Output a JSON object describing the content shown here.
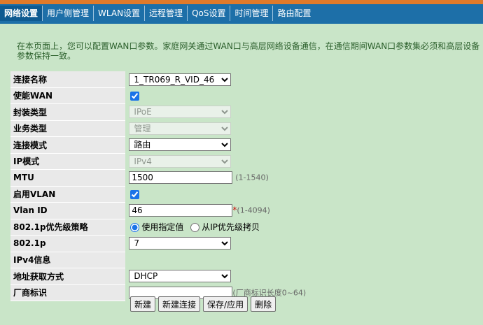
{
  "nav": {
    "items": [
      "网络设置",
      "用户侧管理",
      "WLAN设置",
      "远程管理",
      "QoS设置",
      "时间管理",
      "路由配置"
    ],
    "active_index": 0
  },
  "intro_text": "在本页面上，您可以配置WAN口参数。家庭网关通过WAN口与高层网络设备通信，在通信期间WAN口参数集必须和高层设备参数保持一致。",
  "form": {
    "connection_name": {
      "label": "连接名称",
      "value": "1_TR069_R_VID_46"
    },
    "enable_wan": {
      "label": "使能WAN",
      "checked": true
    },
    "encap_type": {
      "label": "封装类型",
      "value": "IPoE"
    },
    "service_type": {
      "label": "业务类型",
      "value": "管理"
    },
    "conn_mode": {
      "label": "连接模式",
      "value": "路由"
    },
    "ip_mode": {
      "label": "IP模式",
      "value": "IPv4"
    },
    "mtu": {
      "label": "MTU",
      "value": "1500",
      "hint": "(1-1540)"
    },
    "enable_vlan": {
      "label": "启用VLAN",
      "checked": true
    },
    "vlan_id": {
      "label": "Vlan ID",
      "value": "46",
      "required": "*",
      "hint": "(1-4094)"
    },
    "priority_policy": {
      "label": "802.1p优先级策略",
      "option_a": "使用指定值",
      "option_b": "从IP优先级拷贝",
      "selected": "option_a"
    },
    "p8021": {
      "label": "802.1p",
      "value": "7"
    },
    "ipv4_info": {
      "label": "IPv4信息"
    },
    "addr_method": {
      "label": "地址获取方式",
      "value": "DHCP"
    },
    "vendor_id": {
      "label": "厂商标识",
      "value": "",
      "hint": "(厂商标识长度0~64)"
    }
  },
  "buttons": {
    "new": "新建",
    "new_conn": "新建连接",
    "save": "保存/应用",
    "delete": "删除"
  },
  "colors": {
    "background": "#c9e5c8",
    "nav_bar": "#1d6fa8",
    "nav_accent": "#e07a2a",
    "label_bg": "#e9e9e9"
  }
}
